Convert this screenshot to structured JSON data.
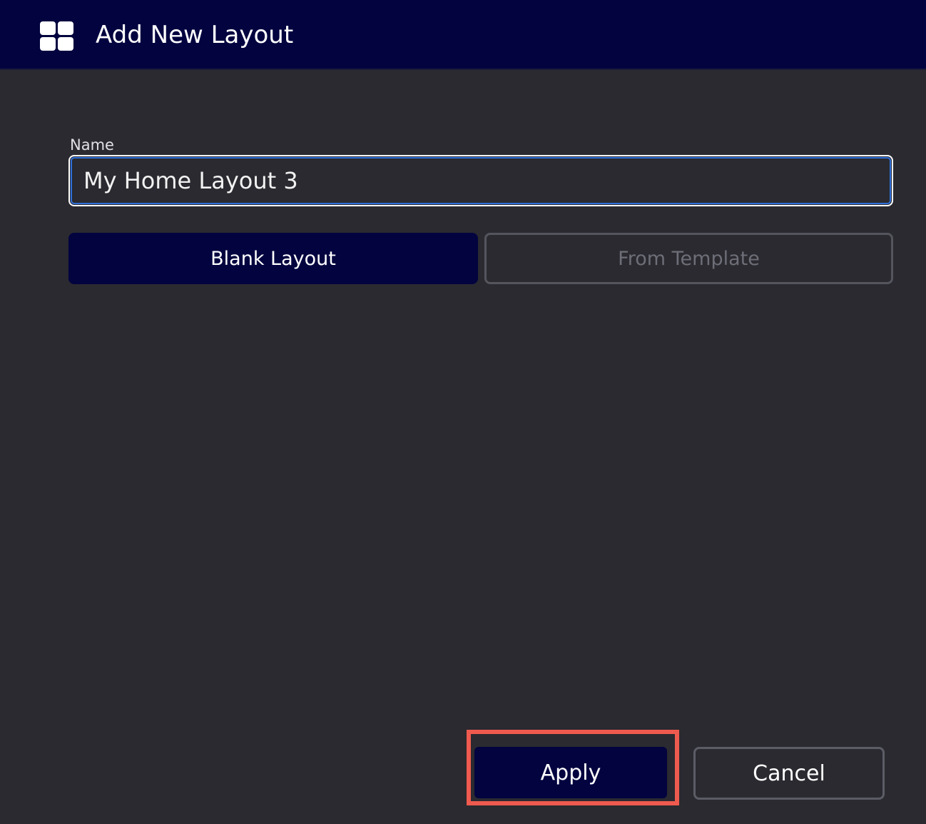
{
  "dialog": {
    "title": "Add New Layout",
    "title_icon": "layout-grid-icon"
  },
  "form": {
    "name_label": "Name",
    "name_value": "My Home Layout 3"
  },
  "layout_type": {
    "options": [
      {
        "label": "Blank Layout",
        "selected": true
      },
      {
        "label": "From Template",
        "selected": false
      }
    ]
  },
  "actions": {
    "apply_label": "Apply",
    "cancel_label": "Cancel"
  },
  "colors": {
    "titlebar_bg": "#02033f",
    "panel_bg": "#2a2a30",
    "input_focus_ring": "#2f6fd8",
    "highlight_box": "#ef5a4f"
  }
}
